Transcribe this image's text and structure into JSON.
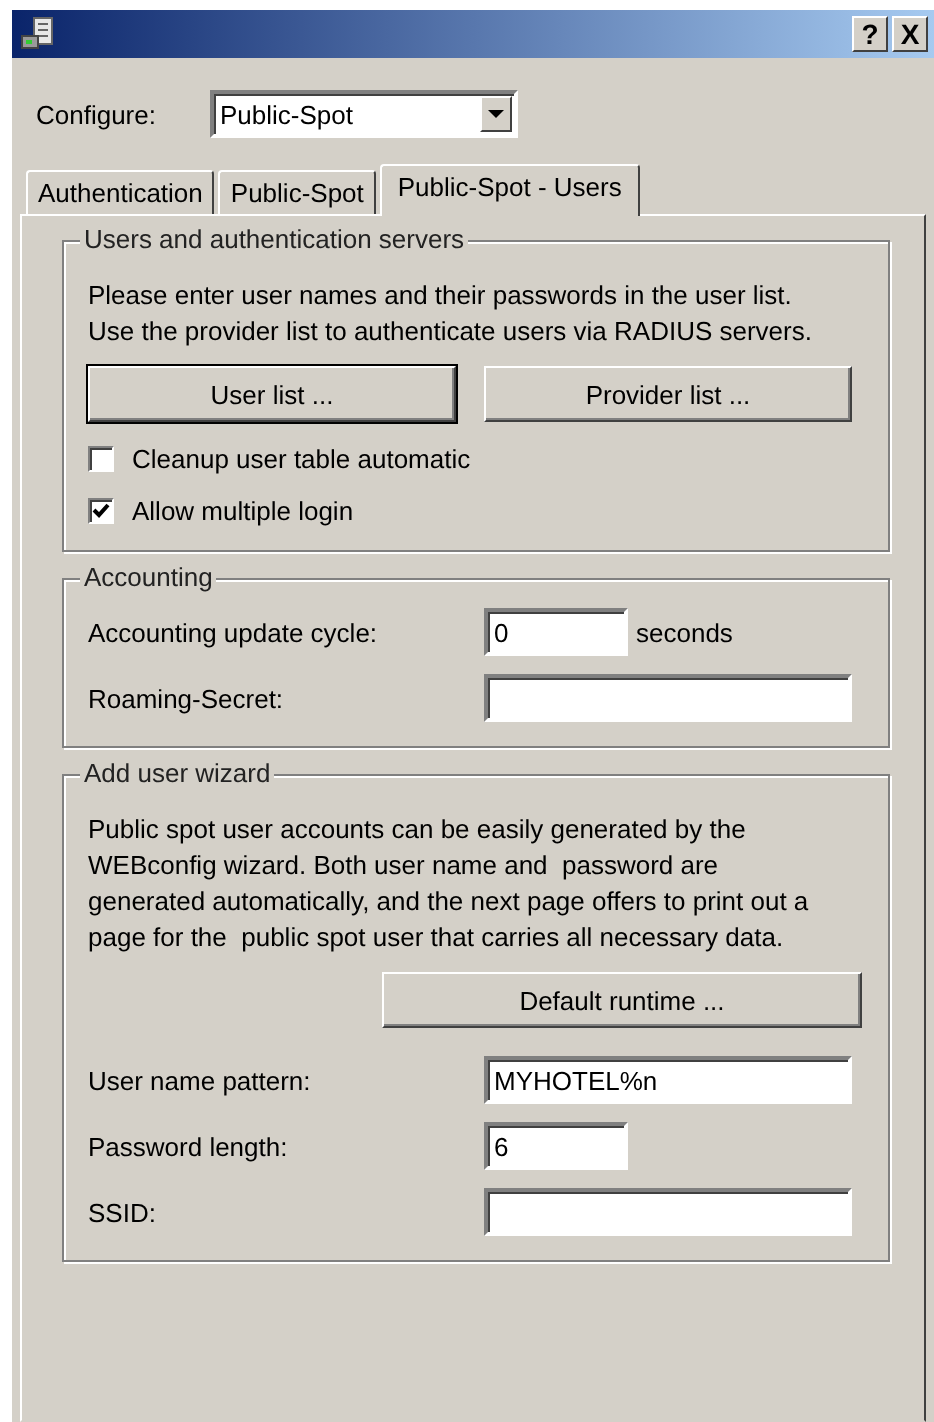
{
  "window": {
    "help_button": "?",
    "close_button": "X"
  },
  "configure": {
    "label": "Configure:",
    "value": "Public-Spot"
  },
  "tabs": [
    {
      "label": "Authentication",
      "selected": false
    },
    {
      "label": "Public-Spot",
      "selected": false
    },
    {
      "label": "Public-Spot - Users",
      "selected": true
    }
  ],
  "groups": [
    {
      "title": "Users and authentication servers",
      "items": [
        {
          "kind": "text",
          "text": "Please enter user names and their passwords in the user list.\nUse the provider list to authenticate users via RADIUS servers."
        },
        {
          "kind": "button-pair",
          "buttons": [
            {
              "label": "User list ...",
              "default": true
            },
            {
              "label": "Provider list ...",
              "default": false
            }
          ]
        },
        {
          "kind": "checkbox",
          "label": "Cleanup user table automatic",
          "checked": false
        },
        {
          "kind": "checkbox",
          "label": "Allow multiple login",
          "checked": true
        }
      ]
    },
    {
      "title": "Accounting",
      "items": [
        {
          "kind": "short-field",
          "label": "Accounting update cycle:",
          "value": "0",
          "suffix": "seconds"
        },
        {
          "kind": "field",
          "label": "Roaming-Secret:"
        }
      ]
    },
    {
      "title": "Add user wizard",
      "items": [
        {
          "kind": "text",
          "text": "Public spot user accounts can be easily generated by the\nWEBconfig wizard. Both user name and  password are\ngenerated automatically, and the next page offers to print out a\npage for the  public spot user that carries all necessary data."
        },
        {
          "kind": "button",
          "label": "Default runtime ...",
          "default": false
        },
        {
          "kind": "field",
          "label": "User name pattern:",
          "value": "MYHOTEL%n"
        },
        {
          "kind": "short-field",
          "label": "Password length:",
          "value": "6"
        },
        {
          "kind": "field",
          "label": "SSID:"
        }
      ]
    }
  ]
}
